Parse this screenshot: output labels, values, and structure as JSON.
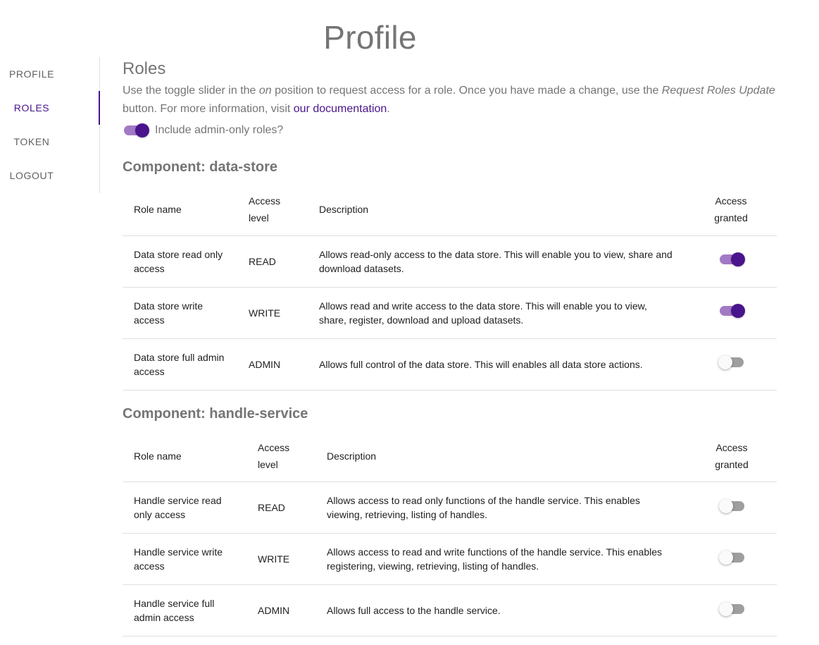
{
  "page": {
    "title": "Profile"
  },
  "nav": {
    "items": [
      {
        "label": "PROFILE",
        "active": false
      },
      {
        "label": "ROLES",
        "active": true
      },
      {
        "label": "TOKEN",
        "active": false
      },
      {
        "label": "LOGOUT",
        "active": false
      }
    ]
  },
  "roles": {
    "heading": "Roles",
    "intro": {
      "part1": "Use the toggle slider in the ",
      "on_word": "on",
      "part2": " position to request access for a role. Once you have made a change, use the ",
      "button_name": "Request Roles Update",
      "part3": " button. For more information, visit ",
      "link_text": "our documentation",
      "part4": "."
    },
    "admin_toggle": {
      "label": "Include admin-only roles?",
      "checked": true
    }
  },
  "table_headers": {
    "role_name": "Role name",
    "access_level_line1": "Access",
    "access_level_line2": "level",
    "description": "Description",
    "granted_line1": "Access",
    "granted_line2": "granted"
  },
  "components": [
    {
      "heading": "Component: data-store",
      "rows": [
        {
          "name": "Data store read only access",
          "level": "READ",
          "description": "Allows read-only access to the data store. This will enable you to view, share and download datasets.",
          "granted": true
        },
        {
          "name": "Data store write access",
          "level": "WRITE",
          "description": "Allows read and write access to the data store. This will enable you to view, share, register, download and upload datasets.",
          "granted": true
        },
        {
          "name": "Data store full admin access",
          "level": "ADMIN",
          "description": "Allows full control of the data store. This will enables all data store actions.",
          "granted": false
        }
      ]
    },
    {
      "heading": "Component: handle-service",
      "rows": [
        {
          "name": "Handle service read only access",
          "level": "READ",
          "description": "Allows access to read only functions of the handle service. This enables viewing, retrieving, listing of handles.",
          "granted": false
        },
        {
          "name": "Handle service write access",
          "level": "WRITE",
          "description": "Allows access to read and write functions of the handle service. This enables registering, viewing, retrieving, listing of handles.",
          "granted": false
        },
        {
          "name": "Handle service full admin access",
          "level": "ADMIN",
          "description": "Allows full access to the handle service.",
          "granted": false
        }
      ]
    }
  ],
  "colors": {
    "accent": "#4a148c",
    "accent_track": "#a279c4",
    "muted_text": "#757575",
    "divider": "#e0e0e0"
  }
}
